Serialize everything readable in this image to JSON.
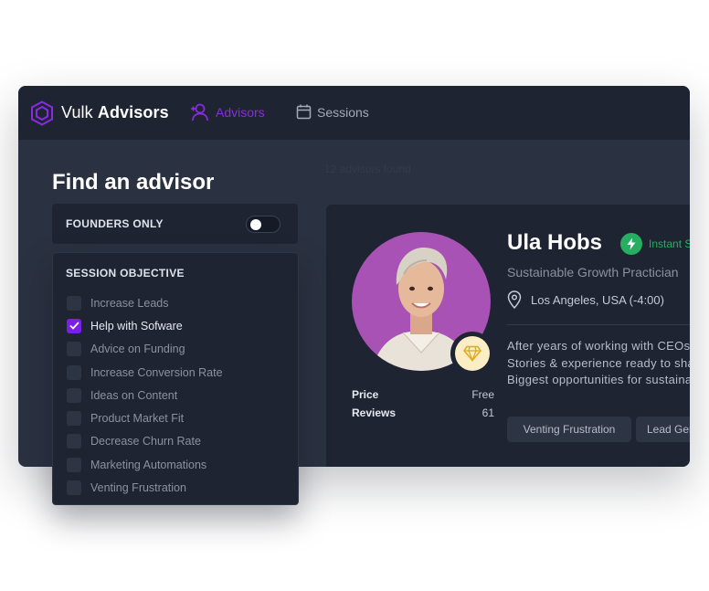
{
  "app": {
    "brand_regular": "Vulk",
    "brand_bold": "Advisors"
  },
  "nav": {
    "advisors": "Advisors",
    "sessions": "Sessions"
  },
  "colors": {
    "accent": "#8a2be2",
    "checkbox_checked": "#7b1fe4",
    "instant_green": "#27ae60",
    "avatar_bg": "#a752b4"
  },
  "page": {
    "title": "Find an advisor",
    "results_count": "12 advisors found"
  },
  "filters": {
    "founders_only_label": "FOUNDERS ONLY",
    "founders_only_on": false,
    "objective_title": "SESSION OBJECTIVE",
    "objectives": [
      {
        "label": "Increase Leads",
        "checked": false
      },
      {
        "label": "Help with Sofware",
        "checked": true
      },
      {
        "label": "Advice on Funding",
        "checked": false
      },
      {
        "label": "Increase Conversion Rate",
        "checked": false
      },
      {
        "label": "Ideas on Content",
        "checked": false
      },
      {
        "label": "Product Market Fit",
        "checked": false
      },
      {
        "label": "Decrease Churn Rate",
        "checked": false
      },
      {
        "label": "Marketing Automations",
        "checked": false
      },
      {
        "label": "Venting Frustration",
        "checked": false
      }
    ]
  },
  "advisor": {
    "name": "Ula Hobs",
    "instant": "Instant Session",
    "title": "Sustainable Growth Practician",
    "location": "Los Angeles, USA (-4:00)",
    "bio_lines": [
      "After years of working with CEOs",
      "Stories & experience ready to share",
      "Biggest opportunities for sustainable"
    ],
    "price_label": "Price",
    "price_value": "Free",
    "reviews_label": "Reviews",
    "reviews_value": "61",
    "tags": [
      "Venting Frustration",
      "Lead Generation"
    ],
    "badge_icon": "diamond-icon"
  }
}
